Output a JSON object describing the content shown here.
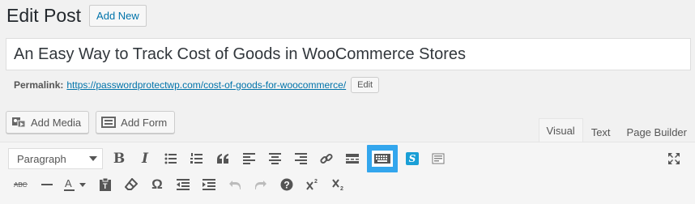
{
  "header": {
    "title": "Edit Post",
    "add_new": "Add New"
  },
  "post": {
    "title": "An Easy Way to Track Cost of Goods in WooCommerce Stores"
  },
  "permalink": {
    "label": "Permalink:",
    "url": "https://passwordprotectwp.com/cost-of-goods-for-woocommerce/",
    "edit": "Edit"
  },
  "media": {
    "add_media": "Add Media",
    "add_form": "Add Form"
  },
  "tabs": [
    {
      "label": "Visual",
      "active": true
    },
    {
      "label": "Text",
      "active": false
    },
    {
      "label": "Page Builder",
      "active": false
    }
  ],
  "toolbar": {
    "format_value": "Paragraph",
    "row1": [
      "bold",
      "italic",
      "bulleted-list",
      "numbered-list",
      "blockquote",
      "align-left",
      "align-center",
      "align-right",
      "insert-link",
      "read-more",
      "toolbar-toggle",
      "shortcode",
      "form"
    ],
    "row2": [
      "strikethrough",
      "horizontal-line",
      "text-color",
      "paste-as-text",
      "clear-formatting",
      "special-character",
      "outdent",
      "indent",
      "undo",
      "redo",
      "help",
      "superscript",
      "subscript"
    ],
    "highlight_color": "#33a6ed",
    "bold_label": "B",
    "italic_label": "I",
    "omega": "Ω",
    "help": "?"
  }
}
